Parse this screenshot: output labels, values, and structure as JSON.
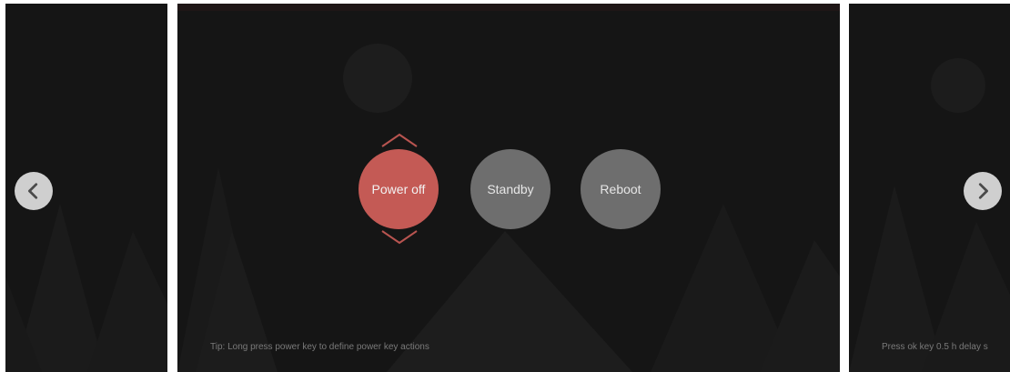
{
  "colors": {
    "panel_bg": "#151515",
    "selected_button": "#c45a55",
    "normal_button": "#6e6e6e",
    "nav_arrow_bg": "#cfcfcf"
  },
  "navigation": {
    "prev_icon": "chevron-left-icon",
    "next_icon": "chevron-right-icon"
  },
  "power_menu": {
    "options": [
      {
        "label": "Power off",
        "selected": true
      },
      {
        "label": "Standby",
        "selected": false
      },
      {
        "label": "Reboot",
        "selected": false
      }
    ],
    "up_icon": "chevron-up-icon",
    "down_icon": "chevron-down-icon"
  },
  "tips": {
    "center": "Tip: Long press power key to define power key actions",
    "right": "Press ok key  0.5 h  delay s"
  }
}
